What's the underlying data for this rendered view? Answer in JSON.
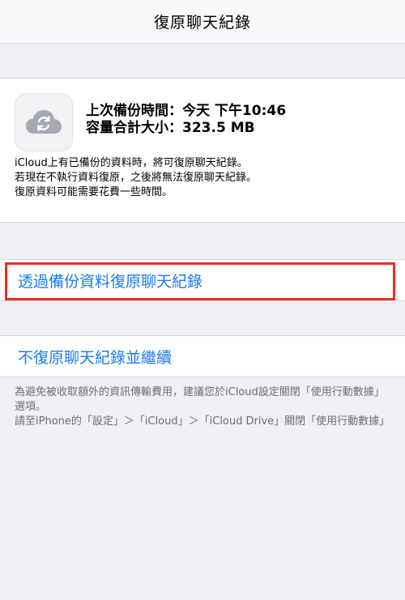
{
  "nav": {
    "title": "復原聊天紀錄"
  },
  "backup": {
    "last_backup": "上次備份時間：今天 下午10:46",
    "total_size": "容量合計大小：323.5 MB",
    "description": [
      "iCloud上有已備份的資料時，將可復原聊天紀錄。",
      "若現在不執行資料復原，之後將無法復原聊天紀錄。",
      "復原資料可能需要花費一些時間。"
    ]
  },
  "actions": {
    "restore_label": "透過備份資料復原聊天紀錄",
    "skip_label": "不復原聊天紀錄並繼續"
  },
  "footer": {
    "lines": [
      "為避免被收取額外的資訊傳輸費用，建議您於iCloud設定關閉「使用行動數據」選項。",
      "請至iPhone的「設定」＞「iCloud」＞「iCloud Drive」關閉「使用行動數據」"
    ]
  },
  "colors": {
    "link": "#1a7bf0",
    "highlight": "#e8301d",
    "background": "#efeff4"
  },
  "icons": {
    "backup": "icloud-sync-icon"
  }
}
